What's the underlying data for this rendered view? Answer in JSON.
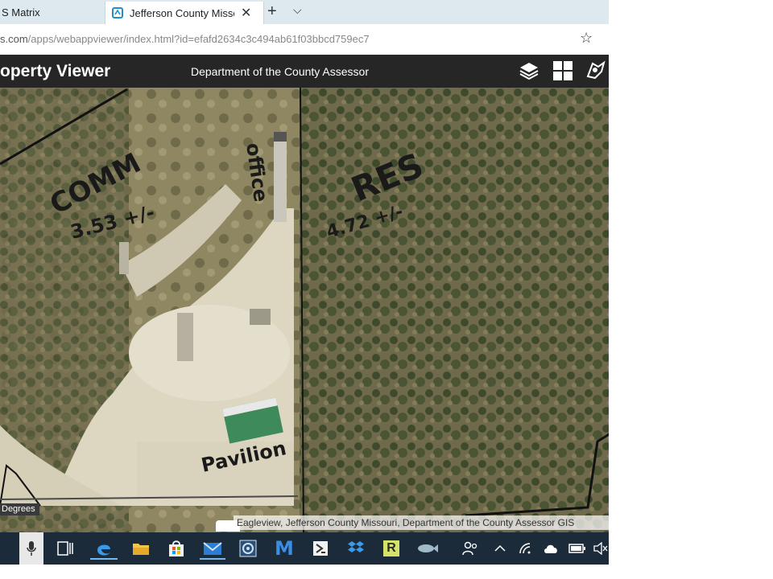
{
  "browser": {
    "tabs": [
      {
        "label": "S Matrix",
        "active": false
      },
      {
        "label": "Jefferson County Missouri",
        "active": true
      }
    ],
    "new_tab_symbol": "+",
    "tab_menu_symbol": "⌵",
    "close_symbol": "✕",
    "url_host": "s.com",
    "url_path": "/apps/webappviewer/index.html?id=efafd2634c3c494ab61f03bbcd759ec7",
    "favorite_symbol": "☆"
  },
  "app": {
    "title": "operty Viewer",
    "subtitle": "Department of the County Assessor",
    "header_icons": [
      "layers-icon",
      "basemap-gallery-icon",
      "legend-icon"
    ]
  },
  "map": {
    "annotations": {
      "comm_label": "COMM",
      "comm_acres": "3.53 +/-",
      "office_label": "office",
      "res_label": "RES",
      "res_acres": "4.72 +/-",
      "pavilion_label": "Pavilion"
    },
    "scale_label": "Degrees",
    "attribution": "Eagleview, Jefferson County Missouri, Department of the County Assessor GIS"
  },
  "taskbar": {
    "icons": [
      "microphone-icon",
      "task-view-icon",
      "edge-icon",
      "file-explorer-icon",
      "store-icon",
      "mail-icon",
      "settings-app-icon",
      "m-app-icon",
      "terminal-app-icon",
      "dropbox-icon",
      "r-app-icon",
      "fish-app-icon",
      "people-icon",
      "chevron-up-icon",
      "wifi-icon",
      "cloud-icon",
      "battery-icon",
      "volume-mute-icon"
    ],
    "m_app_letter": "M",
    "r_app_letter": "R",
    "mute_symbol": "🔇"
  },
  "colors": {
    "header_bg": "#262626",
    "tabbar_bg": "#dde9ef",
    "taskbar_bg": "#1b2b3a",
    "accent": "#0078d7"
  }
}
